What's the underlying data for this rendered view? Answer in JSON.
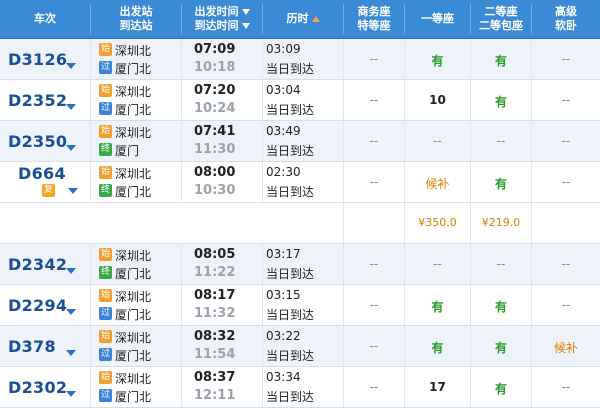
{
  "header": {
    "train_no": "车次",
    "station_depart": "出发站",
    "station_arrive": "到达站",
    "time_depart": "出发时间",
    "time_arrive": "到达时间",
    "duration": "历时",
    "business_1": "商务座",
    "business_2": "特等座",
    "first_class": "一等座",
    "second_1": "二等座",
    "second_2": "二等包座",
    "soft_1": "高级",
    "soft_2": "软卧"
  },
  "badges": {
    "start": "始",
    "pass": "过",
    "end": "终",
    "fu": "复"
  },
  "trains": [
    {
      "no": "D3126",
      "from_badge": "始",
      "from": "深圳北",
      "to_badge": "过",
      "to": "厦门北",
      "dep": "07:09",
      "arr": "10:18",
      "dur": "03:09",
      "note": "当日到达",
      "business": "--",
      "first": "有",
      "second": "有",
      "soft": "--"
    },
    {
      "no": "D2352",
      "from_badge": "始",
      "from": "深圳北",
      "to_badge": "过",
      "to": "厦门北",
      "dep": "07:20",
      "arr": "10:24",
      "dur": "03:04",
      "note": "当日到达",
      "business": "--",
      "first": "10",
      "second": "有",
      "soft": "--"
    },
    {
      "no": "D2350",
      "from_badge": "始",
      "from": "深圳北",
      "to_badge": "终",
      "to": "厦门",
      "dep": "07:41",
      "arr": "11:30",
      "dur": "03:49",
      "note": "当日到达",
      "business": "--",
      "first": "--",
      "second": "--",
      "soft": "--"
    },
    {
      "no": "D664",
      "fu": "复",
      "from_badge": "始",
      "from": "深圳北",
      "to_badge": "终",
      "to": "厦门北",
      "dep": "08:00",
      "arr": "10:30",
      "dur": "02:30",
      "note": "当日到达",
      "business": "--",
      "first": "候补",
      "second": "有",
      "soft": "--",
      "price_first": "¥350.0",
      "price_second": "¥219.0"
    },
    {
      "no": "D2342",
      "from_badge": "始",
      "from": "深圳北",
      "to_badge": "终",
      "to": "厦门北",
      "dep": "08:05",
      "arr": "11:22",
      "dur": "03:17",
      "note": "当日到达",
      "business": "--",
      "first": "--",
      "second": "--",
      "soft": "--"
    },
    {
      "no": "D2294",
      "from_badge": "始",
      "from": "深圳北",
      "to_badge": "过",
      "to": "厦门北",
      "dep": "08:17",
      "arr": "11:32",
      "dur": "03:15",
      "note": "当日到达",
      "business": "--",
      "first": "有",
      "second": "有",
      "soft": "--"
    },
    {
      "no": "D378",
      "from_badge": "始",
      "from": "深圳北",
      "to_badge": "过",
      "to": "厦门北",
      "dep": "08:32",
      "arr": "11:54",
      "dur": "03:22",
      "note": "当日到达",
      "business": "--",
      "first": "有",
      "second": "有",
      "soft": "候补"
    },
    {
      "no": "D2302",
      "from_badge": "始",
      "from": "深圳北",
      "to_badge": "过",
      "to": "厦门北",
      "dep": "08:37",
      "arr": "12:11",
      "dur": "03:34",
      "note": "当日到达",
      "business": "--",
      "first": "17",
      "second": "有",
      "soft": "--"
    }
  ],
  "colors": {
    "header_bg": "#3a8ad6",
    "train_blue": "#1b4f95",
    "available_green": "#2a9a2a",
    "waitlist_orange": "#e07b00"
  }
}
